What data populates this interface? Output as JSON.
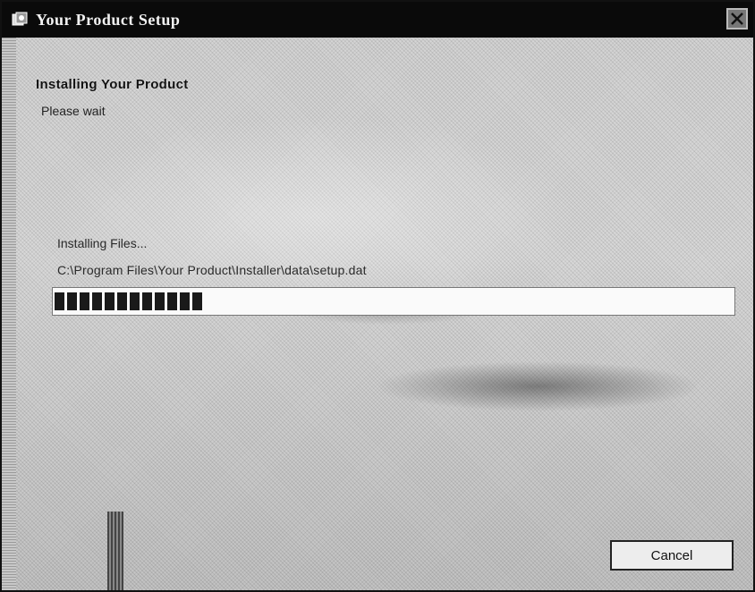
{
  "window": {
    "title": "Your Product Setup",
    "app_icon": "installer-icon",
    "close_icon": "close-icon"
  },
  "header": {
    "title": "Installing Your Product",
    "subtitle": "Please wait"
  },
  "status": {
    "label": "Installing Files...",
    "current_file": "C:\\Program Files\\Your Product\\Installer\\data\\setup.dat",
    "progress_percent": 22
  },
  "footer": {
    "cancel_label": "Cancel"
  }
}
